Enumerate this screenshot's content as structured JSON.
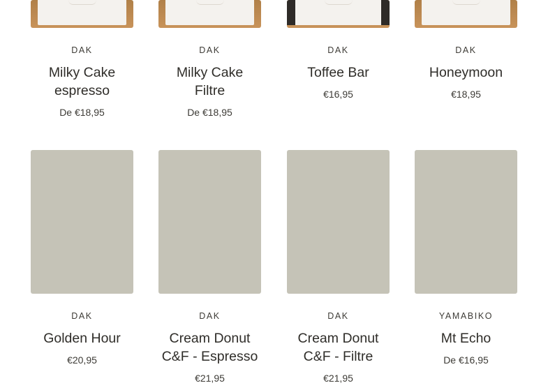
{
  "row1": [
    {
      "vendor": "DAK",
      "title": "Milky Cake espresso",
      "price": "De €18,95"
    },
    {
      "vendor": "DAK",
      "title": "Milky Cake Filtre",
      "price": "De €18,95"
    },
    {
      "vendor": "DAK",
      "title": "Toffee Bar",
      "price": "€16,95"
    },
    {
      "vendor": "DAK",
      "title": "Honeymoon",
      "price": "€18,95"
    }
  ],
  "row2": [
    {
      "vendor": "DAK",
      "title": "Golden Hour",
      "price": "€20,95"
    },
    {
      "vendor": "DAK",
      "title": "Cream Donut C&F - Espresso",
      "price": "€21,95"
    },
    {
      "vendor": "DAK",
      "title": "Cream Donut C&F - Filtre",
      "price": "€21,95"
    },
    {
      "vendor": "YAMABIKO",
      "title": "Mt Echo",
      "price": "De €16,95"
    }
  ],
  "colors": {
    "placeholder": "#c5c3b7",
    "text": "#2f2d29"
  }
}
